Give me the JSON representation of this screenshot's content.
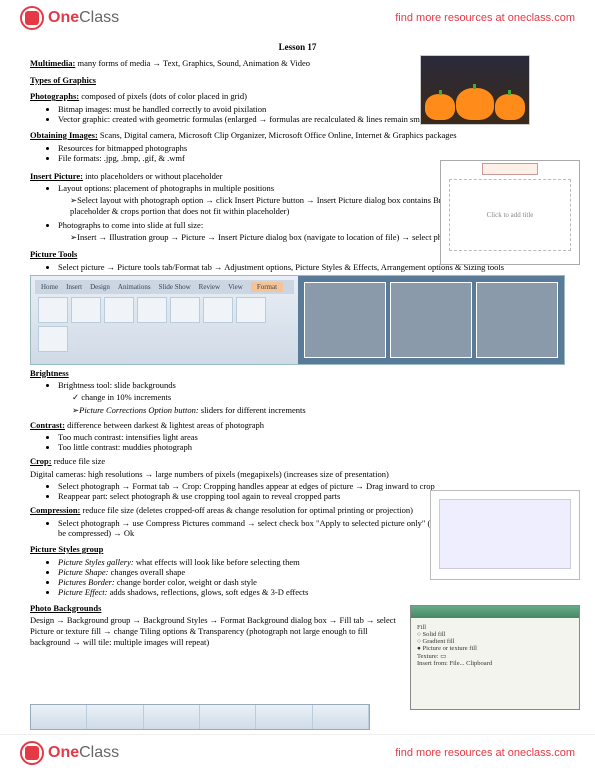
{
  "brand": {
    "one": "One",
    "class": "Class",
    "link": "find more resources at oneclass.com"
  },
  "lesson": "Lesson 17",
  "multimedia": {
    "head": "Multimedia:",
    "body": " many forms of media → Text, Graphics, Sound, Animation & Video"
  },
  "types_head": "Types of Graphics",
  "photos": {
    "head": "Photographs:",
    "body": " composed of pixels (dots of color placed in grid)",
    "b1": "Bitmap images: must be handled correctly to avoid pixilation",
    "b2": "Vector graphic: created with geometric formulas (enlarged → formulas are recalculated & lines remain smooth)"
  },
  "obtain": {
    "head": "Obtaining Images:",
    "body": " Scans, Digital camera, Microsoft Clip Organizer, Microsoft Office Online, Internet & Graphics packages",
    "b1": "Resources for bitmapped photographs",
    "b2": "File formats: .jpg, .bmp, .gif, & .wmf"
  },
  "insert": {
    "head": "Insert Picture:",
    "body": " into placeholders or without placeholder",
    "b1": "Layout options: placement of photographs in multiple positions",
    "b1a": "Select layout with photograph option → click Insert Picture button → Insert Picture dialog box contains Browse option (centers photograph in placeholder & crops portion that does not fit within placeholder)",
    "b2": "Photographs to come into slide at full size:",
    "b2a": "Insert → Illustration group → Picture → Insert Picture dialog box (navigate to location of file) → select photo"
  },
  "tools": {
    "head": "Picture Tools",
    "b1": "Select picture → Picture tools tab/Format tab → Adjustment options, Picture Styles & Effects, Arrangement options & Sizing tools"
  },
  "ribbon_tabs": [
    "Home",
    "Insert",
    "Design",
    "Animations",
    "Slide Show",
    "Review",
    "View",
    "Format"
  ],
  "brightness": {
    "head": "Brightness",
    "b1": "Brightness tool: slide backgrounds",
    "b1a": "change in 10% increments",
    "b1b_i": "Picture Corrections Option button:",
    "b1b": " sliders for different increments"
  },
  "contrast": {
    "head": "Contrast:",
    "body": " difference between darkest & lightest areas of photograph",
    "b1": "Too much contrast: intensifies light areas",
    "b2": "Too little contrast: muddies photograph"
  },
  "crop": {
    "head": "Crop:",
    "body": " reduce file size",
    "l1": "Digital cameras: high resolutions → large numbers of pixels (megapixels) (increases size of presentation)",
    "b1": "Select photograph → Format tab → Crop: Cropping handles appear at edges of picture → Drag inward to crop",
    "b2": "Reappear part: select photograph & use cropping tool again to reveal cropped parts"
  },
  "compress": {
    "head": "Compression:",
    "body": " reduce file size (deletes cropped-off areas & change resolution for optimal printing or projection)",
    "b1": "Select photograph → use Compress Pictures command → select check box \"Apply to selected picture only\" (or else all pictures in presentation will be compressed) → Ok"
  },
  "styles": {
    "head": "Picture Styles group",
    "b1_i": "Picture Styles gallery:",
    "b1": " what effects will look like before selecting them",
    "b2_i": "Picture Shape:",
    "b2": " changes overall shape",
    "b3_i": "Pictures Border:",
    "b3": " change border color, weight or dash style",
    "b4_i": "Picture Effect:",
    "b4": " adds shadows, reflections, glows, soft edges & 3-D effects"
  },
  "bg": {
    "head": "Photo Backgrounds",
    "l1": "Design → Background group → Background Styles → Format Background dialog box → Fill tab → select Picture or texture fill → change Tiling options & Transparency (photograph not large enough to fill background → will tile: multiple images will repeat)"
  },
  "slide_hint": "Click to add title"
}
